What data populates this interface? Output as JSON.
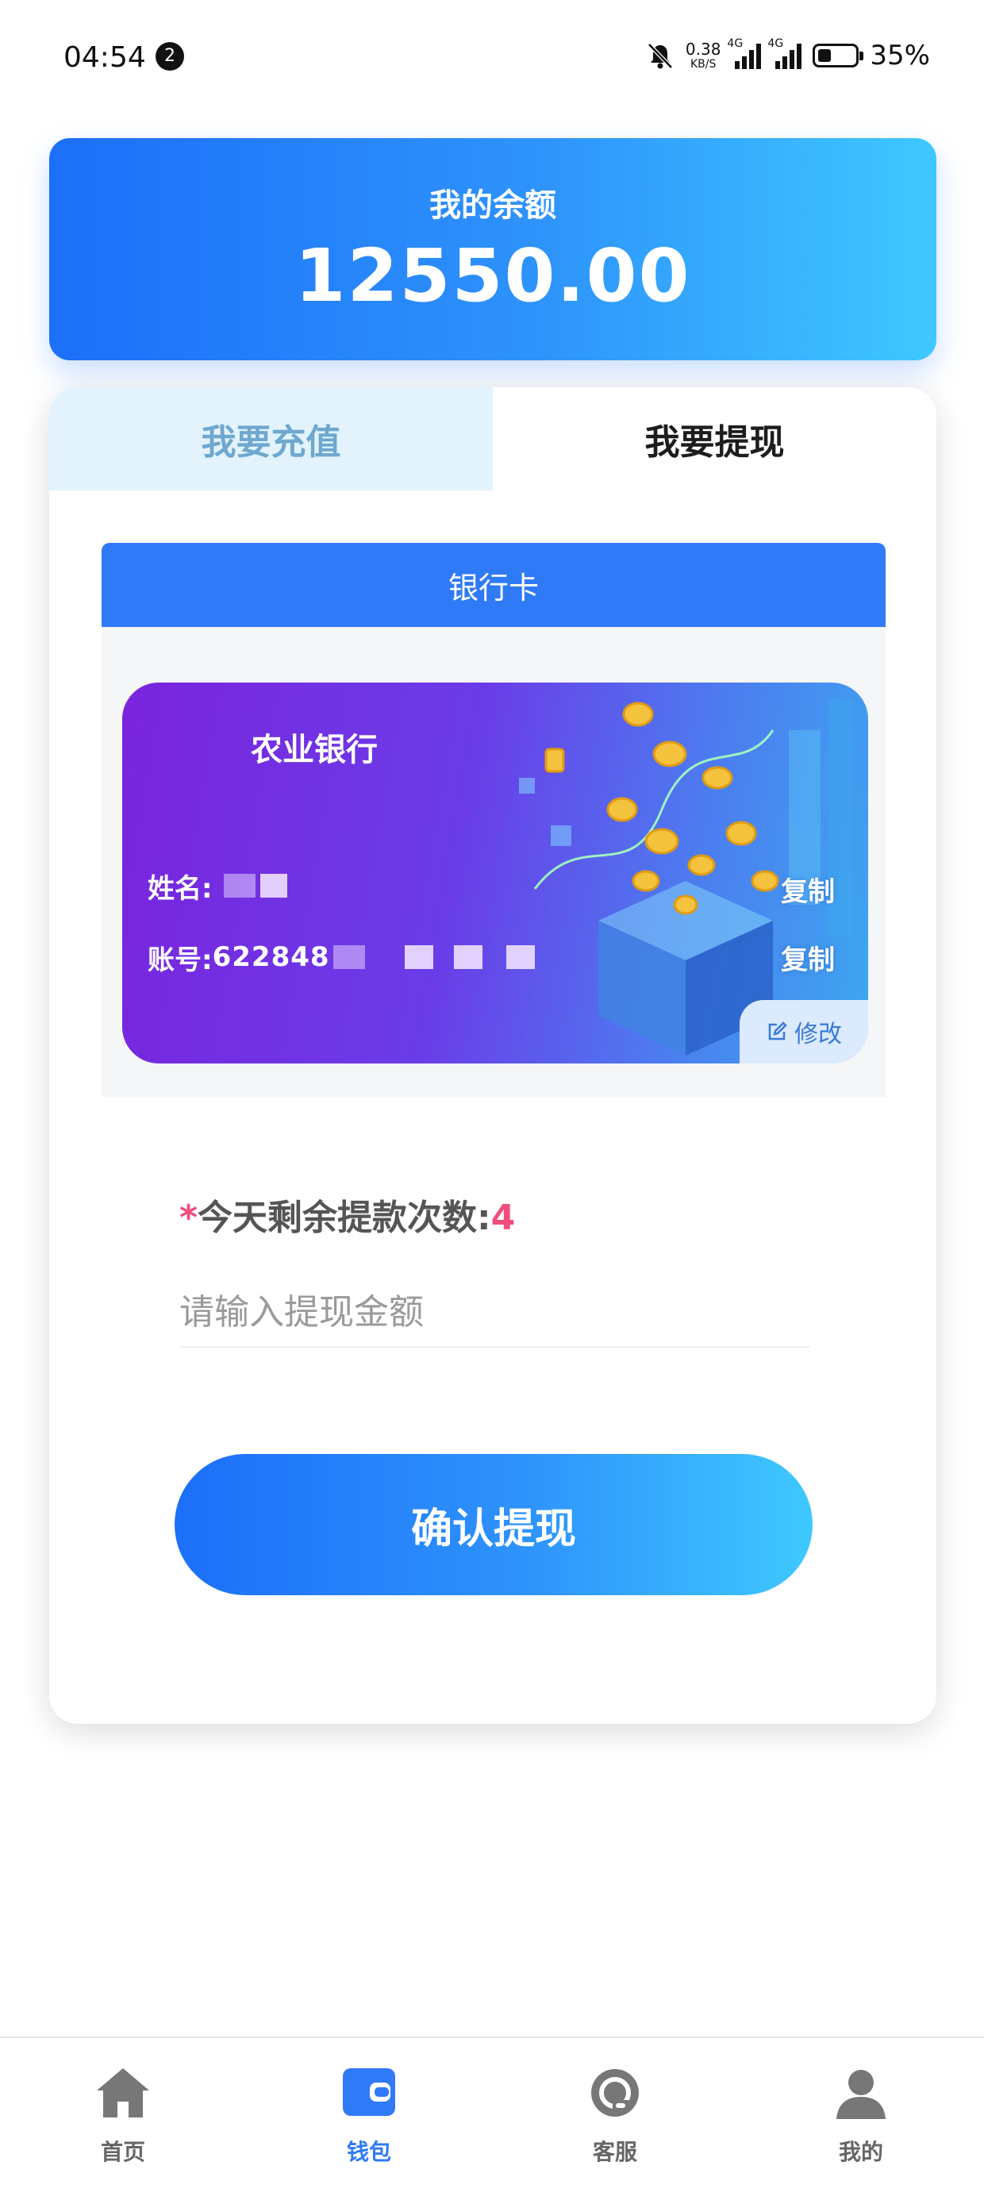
{
  "status_bar": {
    "time": "04:54",
    "notification_count": "2",
    "net_speed": "0.38",
    "net_speed_unit": "KB/S",
    "network_type": "4G",
    "battery_level": 0.35,
    "battery_text": "35%"
  },
  "balance": {
    "title": "我的余额",
    "amount": "12550.00"
  },
  "tabs": [
    {
      "label": "我要充值",
      "active": false
    },
    {
      "label": "我要提现",
      "active": true
    }
  ],
  "withdraw": {
    "method_label": "银行卡",
    "card": {
      "bank_name": "农业银行",
      "name_label": "姓名:",
      "account_label": "账号:",
      "account_prefix": "622848",
      "copy_label": "复制",
      "edit_label": "修改"
    },
    "remaining_star": "*",
    "remaining_label": "今天剩余提款次数:",
    "remaining_count": "4",
    "amount_placeholder": "请输入提现金额",
    "confirm_label": "确认提现"
  },
  "bottom_nav": [
    {
      "label": "首页",
      "icon": "home-icon",
      "active": false
    },
    {
      "label": "钱包",
      "icon": "wallet-icon",
      "active": true
    },
    {
      "label": "客服",
      "icon": "customer-service-icon",
      "active": false
    },
    {
      "label": "我的",
      "icon": "user-icon",
      "active": false
    }
  ],
  "colors": {
    "accent": "#2f7af7",
    "gradient_start": "#1c6ff9",
    "gradient_end": "#3fc8ff",
    "highlight": "#f04d7d",
    "card_purple": "#7a24dd"
  }
}
